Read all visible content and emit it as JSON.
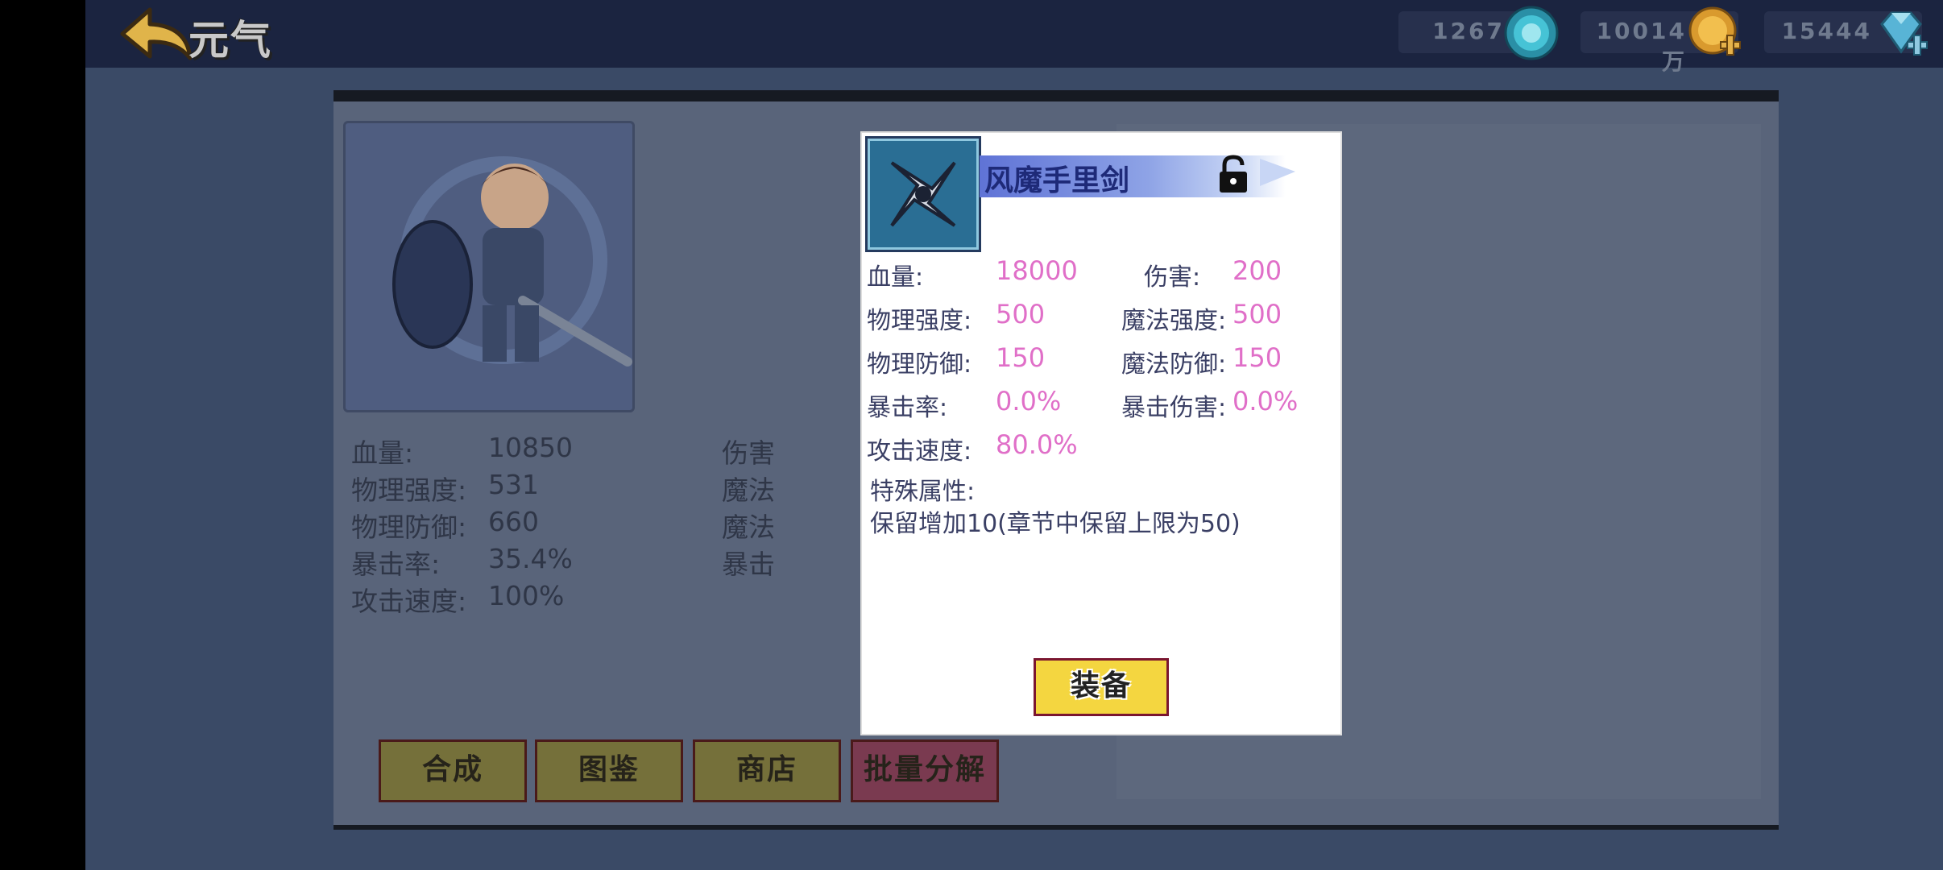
{
  "header": {
    "title": "元气",
    "currencies": [
      {
        "value": "1267",
        "icon": "gem-orb-icon",
        "color": "#3fb0c7"
      },
      {
        "value": "10014万",
        "icon": "gold-coin-add-icon",
        "color": "#e0a13a"
      },
      {
        "value": "15444",
        "icon": "diamond-add-icon",
        "color": "#5fb6d6"
      }
    ]
  },
  "hero": {
    "portrait": "knight-hero-portrait",
    "stats": [
      {
        "label": "血量:",
        "value": "10850"
      },
      {
        "label": "物理强度:",
        "value": "531"
      },
      {
        "label": "物理防御:",
        "value": "660"
      },
      {
        "label": "暴击率:",
        "value": "35.4%"
      },
      {
        "label": "攻击速度:",
        "value": "100%"
      }
    ],
    "stats_right_labels": [
      "伤害",
      "魔法",
      "魔法",
      "暴击"
    ]
  },
  "panel_buttons": [
    "合成",
    "图鉴",
    "商店",
    "批量分解"
  ],
  "item": {
    "name": "风魔手里剑",
    "icon": "shuriken-icon",
    "left_stats": [
      {
        "label": "血量:",
        "value": "18000"
      },
      {
        "label": "物理强度:",
        "value": "500"
      },
      {
        "label": "物理防御:",
        "value": "150"
      },
      {
        "label": "暴击率:",
        "value": "0.0%"
      },
      {
        "label": "攻击速度:",
        "value": "80.0%"
      }
    ],
    "right_stats": [
      {
        "label": "伤害:",
        "value": "200"
      },
      {
        "label": "魔法强度:",
        "value": "500"
      },
      {
        "label": "魔法防御:",
        "value": "150"
      },
      {
        "label": "暴击伤害:",
        "value": "0.0%"
      }
    ],
    "special_label": "特殊属性:",
    "special_text": "保留增加10(章节中保留上限为50)",
    "equip_label": "装备"
  },
  "colors": {
    "accent_value": "#e06fc8",
    "label": "#3a3f64",
    "button_yellow": "#f4d640",
    "button_border": "#7a1630"
  }
}
